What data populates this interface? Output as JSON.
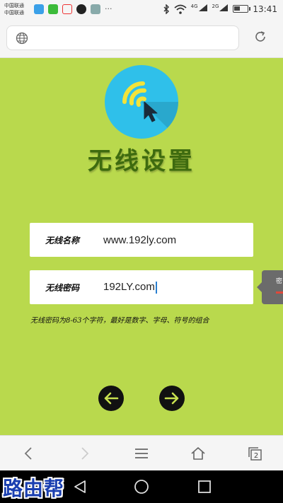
{
  "status_bar": {
    "carrier_1": "中国联通",
    "carrier_2": "中国联通",
    "dots": "···",
    "signal_1": "4G",
    "signal_2": "2G",
    "time": "13:41",
    "battery_level": 0.45
  },
  "address_bar": {
    "url": ""
  },
  "page": {
    "title": "无线设置",
    "ssid_label": "无线名称",
    "ssid_value": "www.192ly.com",
    "password_label": "无线密码",
    "password_value": "192LY.com",
    "tooltip_text": "密",
    "hint": "无线密码为8-63个字符，最好是数字、字母、符号的组合"
  },
  "toolbar": {
    "tab_count": "2"
  },
  "watermark": "路由帮",
  "colors": {
    "page_bg": "#b9d94d",
    "title": "#3e6b0f",
    "logo_bg": "#2fc0ea",
    "logo_arc": "#f2e33a"
  }
}
